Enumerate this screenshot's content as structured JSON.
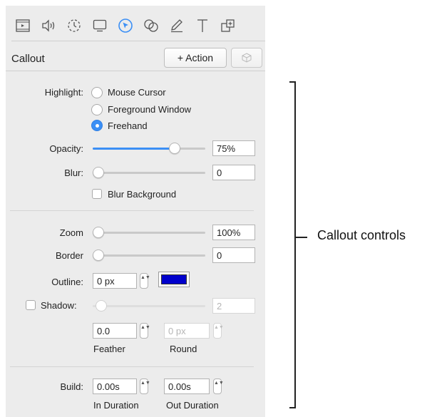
{
  "toolbar": {
    "icons": [
      "film-icon",
      "speaker-icon",
      "dashed-timer-icon",
      "monitor-icon",
      "cursor-highlight-icon",
      "overlap-shapes-icon",
      "pencil-icon",
      "text-icon",
      "duplicate-icon"
    ],
    "active_icon": "cursor-highlight-icon",
    "active_color": "#3b8ff5"
  },
  "header": {
    "title": "Callout",
    "action_label": "+ Action",
    "cube_icon": "cube-icon"
  },
  "highlight": {
    "label": "Highlight:",
    "options": [
      "Mouse Cursor",
      "Foreground Window",
      "Freehand"
    ],
    "selected": "Freehand"
  },
  "opacity": {
    "label": "Opacity:",
    "value": "75%",
    "level": 0.75
  },
  "blur": {
    "label": "Blur:",
    "value": "0",
    "level": 0,
    "background_label": "Blur Background",
    "background_checked": false
  },
  "zoom": {
    "label": "Zoom",
    "value": "100%",
    "level": 0
  },
  "border": {
    "label": "Border",
    "value": "0",
    "level": 0
  },
  "outline": {
    "label": "Outline:",
    "value": "0 px",
    "color": "#0000cc"
  },
  "shadow": {
    "label": "Shadow:",
    "checked": false,
    "value": "2",
    "feather_value": "0.0",
    "feather_label": "Feather",
    "round_value": "0 px",
    "round_label": "Round"
  },
  "build": {
    "label": "Build:",
    "in_value": "0.00s",
    "in_label": "In Duration",
    "out_value": "0.00s",
    "out_label": "Out Duration"
  },
  "annotation": {
    "label": "Callout controls"
  },
  "stepper_glyph": "▲▼"
}
